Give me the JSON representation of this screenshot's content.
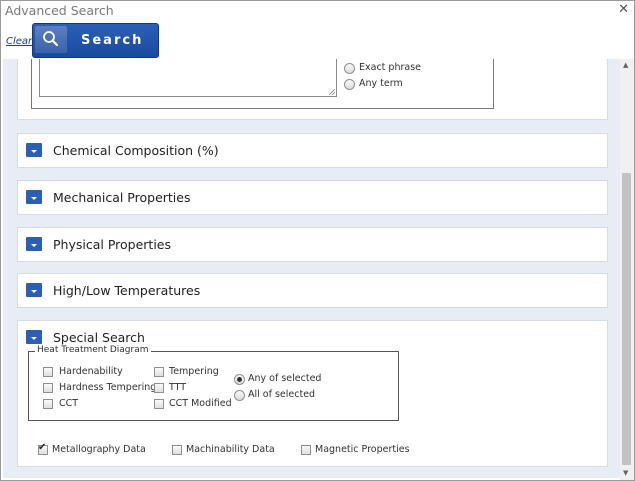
{
  "window": {
    "title": "Advanced Search",
    "close_glyph": "✕"
  },
  "toolbar": {
    "clear_label": "Clear",
    "search_label": "Search"
  },
  "text_match": {
    "options": [
      {
        "label": "Exact phrase",
        "selected": false
      },
      {
        "label": "Any term",
        "selected": false
      }
    ]
  },
  "sections": [
    {
      "title": "Chemical Composition (%)"
    },
    {
      "title": "Mechanical Properties"
    },
    {
      "title": "Physical Properties"
    },
    {
      "title": "High/Low Temperatures"
    },
    {
      "title": "Special Search"
    }
  ],
  "special_search": {
    "heat_treatment": {
      "legend": "Heat Treatment Diagram",
      "col1": [
        {
          "label": "Hardenability",
          "checked": false
        },
        {
          "label": "Hardness Tempering",
          "checked": false
        },
        {
          "label": "CCT",
          "checked": false
        }
      ],
      "col2": [
        {
          "label": "Tempering",
          "checked": false
        },
        {
          "label": "TTT",
          "checked": false
        },
        {
          "label": "CCT Modified",
          "checked": false
        }
      ],
      "match": [
        {
          "label": "Any of selected",
          "selected": true
        },
        {
          "label": "All of selected",
          "selected": false
        }
      ]
    },
    "extra": [
      {
        "label": "Metallography Data",
        "checked": true
      },
      {
        "label": "Machinability Data",
        "checked": false
      },
      {
        "label": "Magnetic Properties",
        "checked": false
      }
    ]
  },
  "colors": {
    "accent": "#2a5fb5",
    "background": "#e8edf5"
  }
}
